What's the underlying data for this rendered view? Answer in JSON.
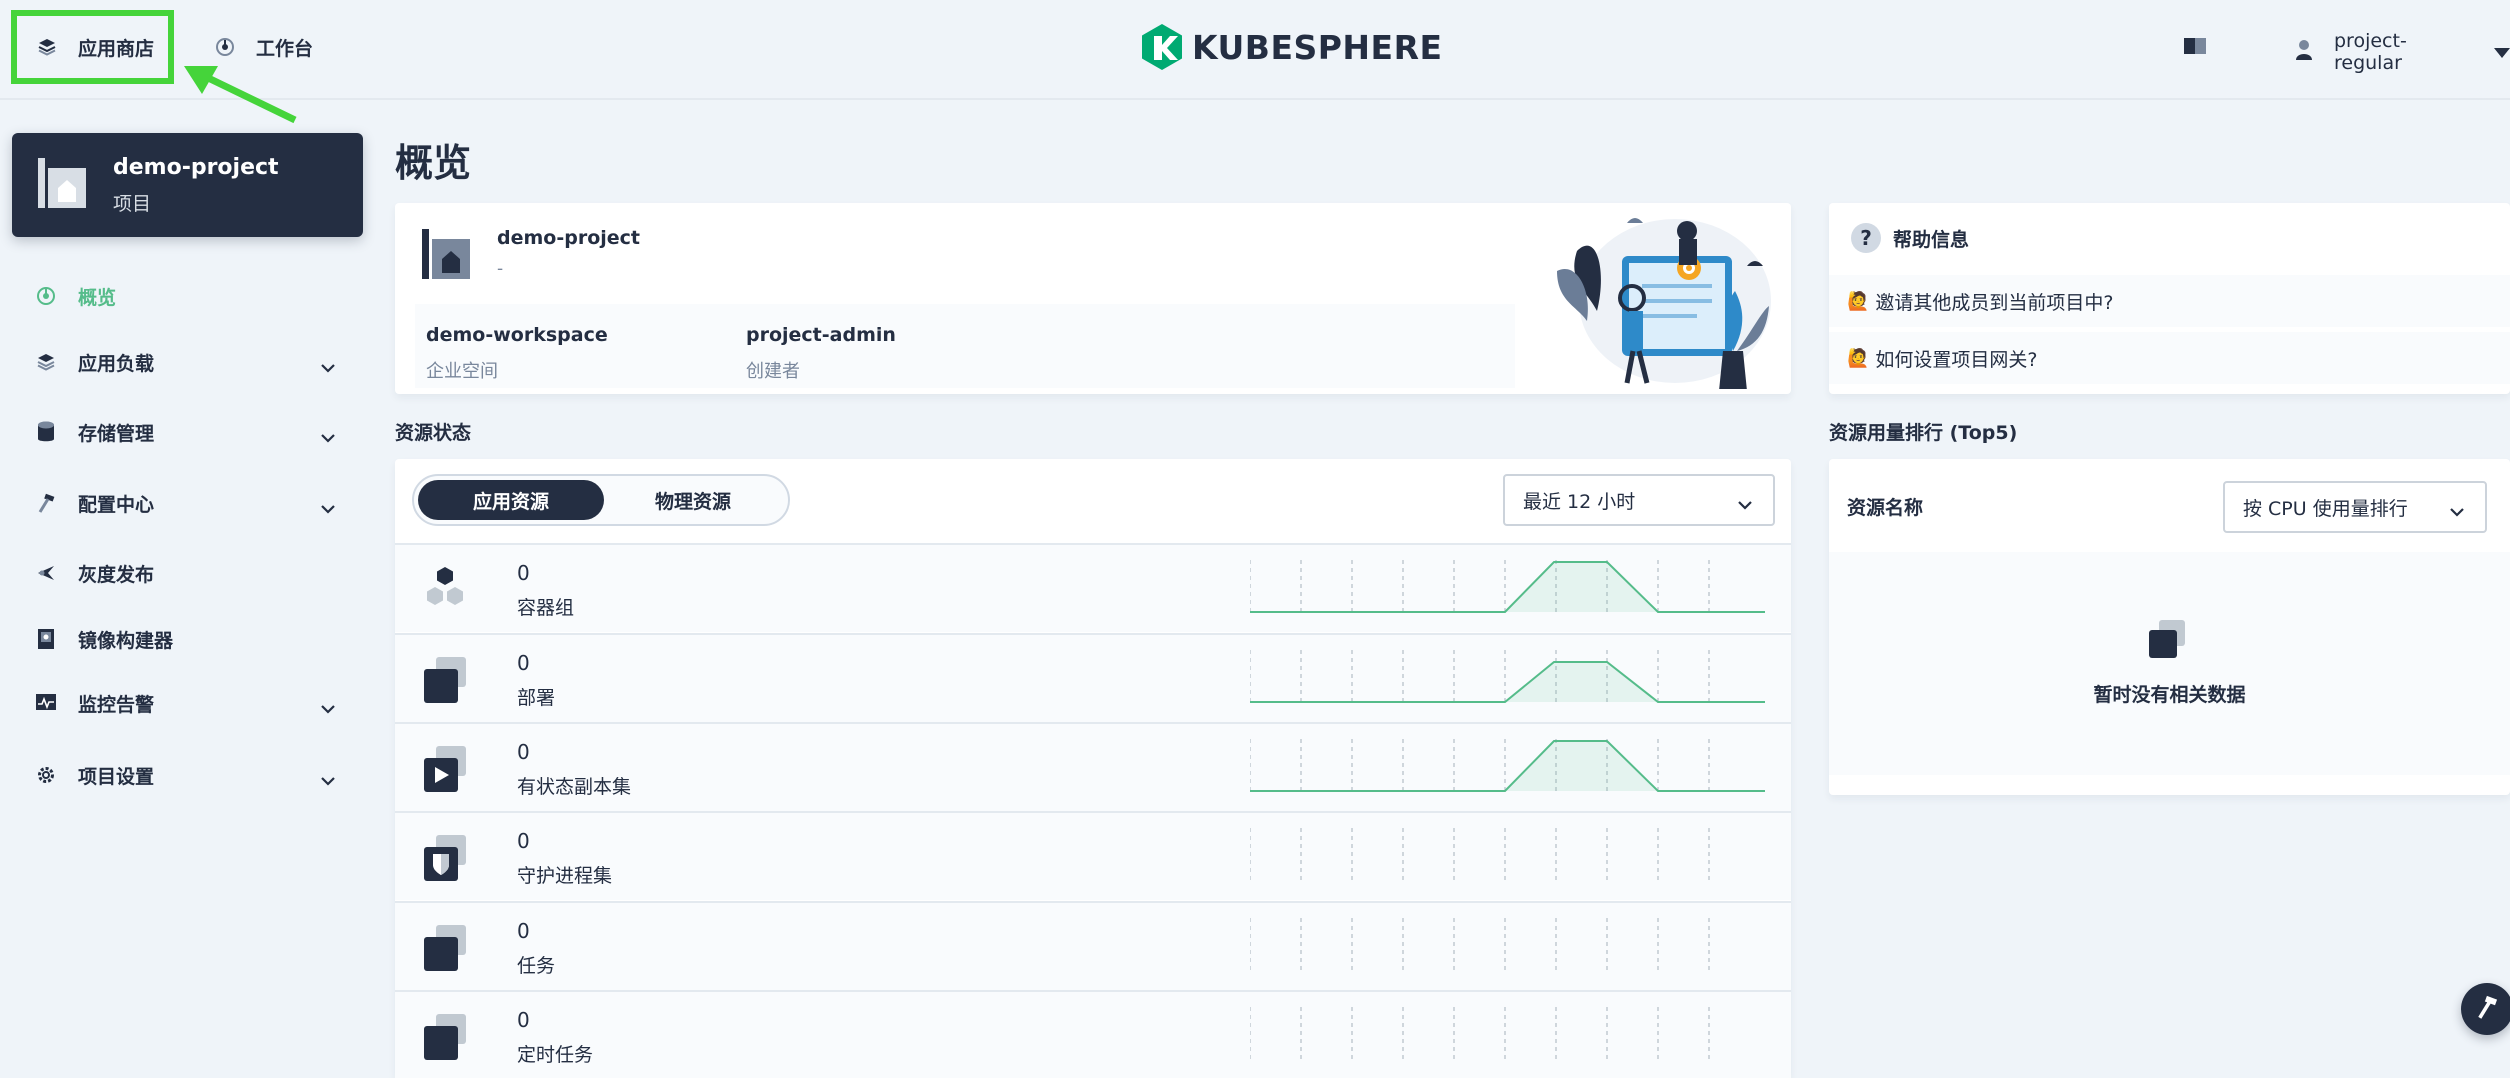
{
  "header": {
    "app_store_label": "应用商店",
    "workbench_label": "工作台",
    "logo_text": "KUBESPHERE",
    "username": "project-regular"
  },
  "sidebar": {
    "project_name": "demo-project",
    "project_type": "项目",
    "items": [
      {
        "label": "概览",
        "active": true
      },
      {
        "label": "应用负载"
      },
      {
        "label": "存储管理"
      },
      {
        "label": "配置中心"
      },
      {
        "label": "灰度发布"
      },
      {
        "label": "镜像构建器"
      },
      {
        "label": "监控告警"
      },
      {
        "label": "项目设置"
      }
    ]
  },
  "main": {
    "page_title": "概览",
    "project": {
      "name": "demo-project",
      "desc": "-",
      "workspace": "demo-workspace",
      "workspace_label": "企业空间",
      "creator": "project-admin",
      "creator_label": "创建者"
    },
    "help": {
      "title": "帮助信息",
      "links": [
        "邀请其他成员到当前项目中?",
        "如何设置项目网关?"
      ]
    },
    "resource_status": {
      "title": "资源状态",
      "tabs": [
        "应用资源",
        "物理资源"
      ],
      "time_range": "最近 12 小时",
      "rows": [
        {
          "count": "0",
          "name": "容器组",
          "has_chart": true
        },
        {
          "count": "0",
          "name": "部署",
          "has_chart": true
        },
        {
          "count": "0",
          "name": "有状态副本集",
          "has_chart": true
        },
        {
          "count": "0",
          "name": "守护进程集",
          "has_chart": false
        },
        {
          "count": "0",
          "name": "任务",
          "has_chart": false
        },
        {
          "count": "0",
          "name": "定时任务",
          "has_chart": false
        }
      ]
    },
    "usage_ranking": {
      "title": "资源用量排行 (Top5)",
      "column_label": "资源名称",
      "sort_select": "按 CPU 使用量排行",
      "empty_text": "暂时没有相关数据"
    }
  },
  "colors": {
    "accent_green": "#55bc8a",
    "dark": "#242e42",
    "highlight": "#45d43a"
  }
}
